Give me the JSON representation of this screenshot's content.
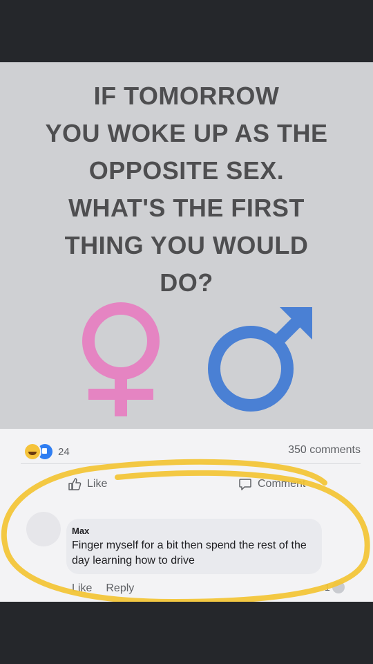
{
  "headline": {
    "lines": [
      "IF TOMORROW",
      "YOU WOKE UP AS THE",
      "OPPOSITE SEX.",
      "WHAT'S THE FIRST",
      "THING YOU WOULD",
      "DO?"
    ]
  },
  "symbols": {
    "female_color": "#e584c2",
    "male_color": "#4a80d4"
  },
  "stats": {
    "reaction_count": "24",
    "comments_count": "350 comments"
  },
  "actions": {
    "like_label": "Like",
    "comment_label": "Comment"
  },
  "comment": {
    "author": "Max",
    "text": "Finger myself for a bit then spend the rest of the day learning how to drive",
    "like_label": "Like",
    "reply_label": "Reply",
    "reaction_count": "1"
  },
  "colors": {
    "highlight": "#f3c433",
    "image_bg": "#cfd0d3",
    "page_bg": "#25272b"
  }
}
